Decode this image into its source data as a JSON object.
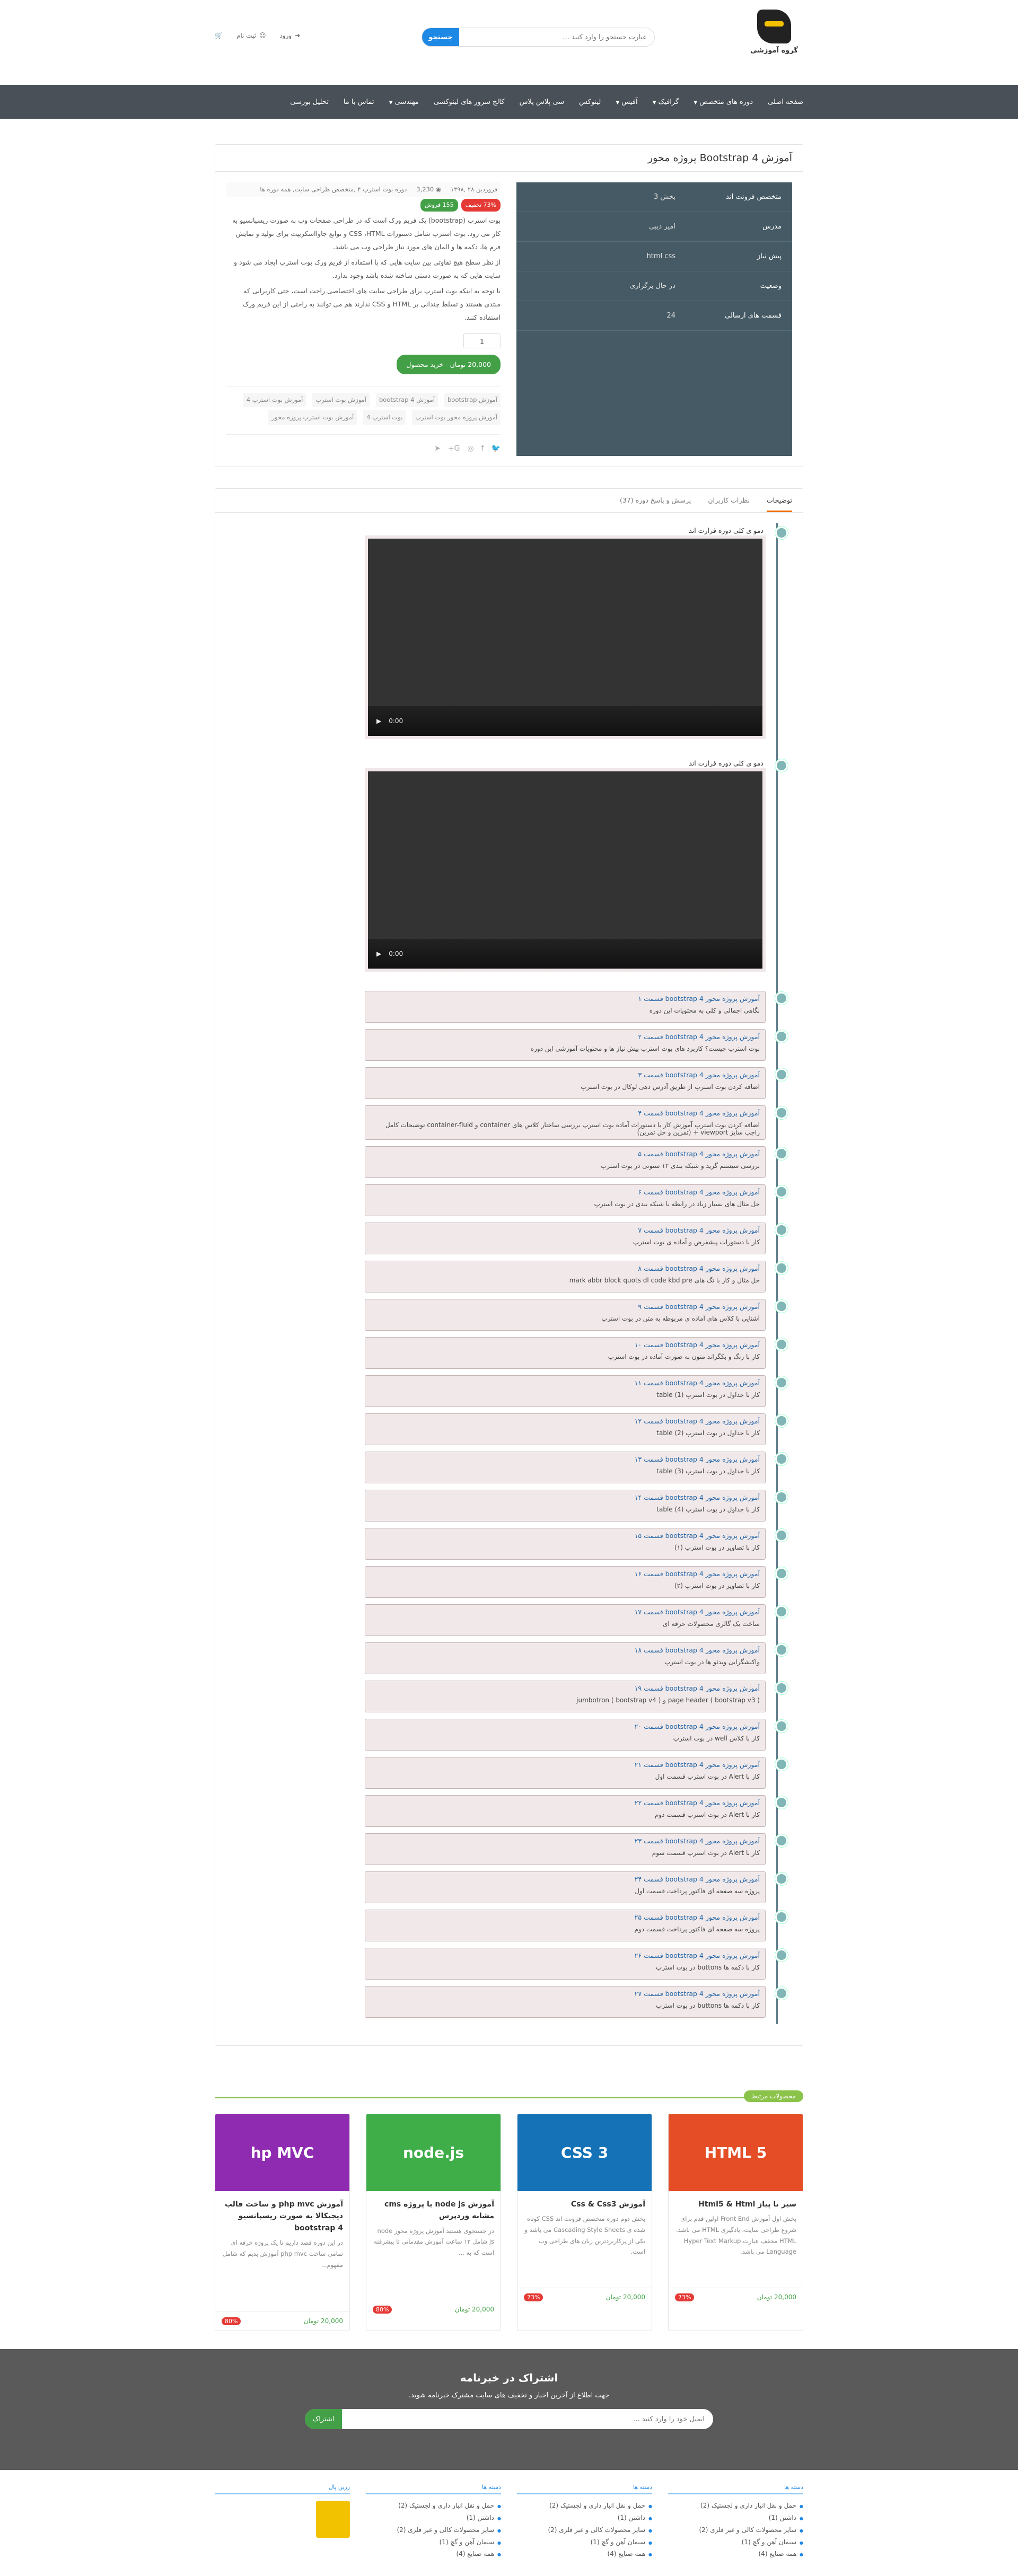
{
  "header": {
    "logo_text": "گروه آموزشی",
    "search": {
      "placeholder": "عبارت جستجو را وارد کنید ...",
      "button": "جستجو"
    },
    "links": {
      "login": "ورود",
      "register": "ثبت نام"
    }
  },
  "nav": [
    "صفحه اصلی",
    "دوره های متخصص",
    "گرافیک",
    "آفیس",
    "لینوکس",
    "سی پلاس پلاس",
    "کالج سرور های لینوکسی",
    "مهندسی",
    "تماس با ما",
    "تحلیل بورسی"
  ],
  "product": {
    "title": "آموزش Bootstrap 4 پروژه محور",
    "info": [
      {
        "k": "متخصص فرونت اند",
        "v": "بخش 3"
      },
      {
        "k": "مدرس",
        "v": "امیر دیبی"
      },
      {
        "k": "پیش نیاز",
        "v": "html css"
      },
      {
        "k": "وضعیت",
        "v": "در حال برگزاری"
      },
      {
        "k": "قسمت های ارسالی",
        "v": "24"
      }
    ],
    "meta": {
      "date": "فروردین ۲۸ ,۱۳۹۸",
      "views": "3,230",
      "category": "دوره بوت استرپ ۴ ,متخصص طراحی سایت, همه دوره ها"
    },
    "discount": "73% تخفیف",
    "remaining": "155 فروش",
    "desc": [
      "بوت استرپ (bootstrap) یک فریم ورک است که در طراحی صفحات وب به صورت ریسپانسیو به کار می رود. بوت استرپ شامل دستورات CSS ،HTML و توابع جاوااسکریپت برای تولید و نمایش فرم ها، دکمه ها و المان های مورد نیاز طراحی وب می باشد.",
      "از نظر سطح هیچ تفاوتی بین سایت هایی که با استفاده از فریم ورک بوت استرپ ایجاد می شود و سایت هایی که به صورت دستی ساخته شده باشد وجود ندارد.",
      "با توجه به اینکه بوت استرپ برای طراحی سایت های اختصاصی راحت است، حتی کاربرانی که مبتدی هستند و تسلط چندانی بر HTML و CSS ندارند هم می توانند به راحتی از این فریم ورک استفاده کنند."
    ],
    "qty": "1",
    "buy": "20,000 تومان - خرید محصول",
    "tags": [
      "آموزش bootstrap",
      "آموزش bootstrap 4",
      "آموزش بوت استرپ",
      "آموزش بوت استرپ 4",
      "آموزش پروژه محور بوت استرپ",
      "بوت استرپ 4",
      "آموزش بوت استرپ پروژه محور"
    ]
  },
  "tabs": [
    "توضیحات",
    "نظرات کاربران",
    "پرسش و پاسخ دوره (37)"
  ],
  "videos": [
    {
      "title": "دمو ی کلی دوره قرارت اند",
      "time": "0:00"
    },
    {
      "title": "دمو ی کلی دوره قرارت اند",
      "time": "0:00"
    }
  ],
  "lessons": [
    {
      "t": "آموزش پروژه محور bootstrap 4 قسمت ۱",
      "s": "نگاهی اجمالی و کلی به محتویات این دوره"
    },
    {
      "t": "آموزش پروژه محور bootstrap 4 قسمت ۲",
      "s": "بوت استرپ چیست؟ کاربرد های بوت استرپ پیش نیاز ها و محتویات آموزشی این دوره"
    },
    {
      "t": "آموزش پروژه محور bootstrap 4 قسمت ۳",
      "s": "اضافه کردن بوت استرپ از طریق آدرس دهی لوکال در بوت استرپ"
    },
    {
      "t": "آموزش پروژه محور bootstrap 4 قسمت ۴",
      "s": "اضافه کردن بوت استرپ آموزش کار با دستورات آماده بوت استرپ بررسی ساختار کلاس های container و container-fluid توضیحات کامل راجب سایز viewport + (تمرین و حل تمرین)"
    },
    {
      "t": "آموزش پروژه محور bootstrap 4 قسمت ۵",
      "s": "بررسی سیستم گرید و شبکه بندی ۱۲ ستونی در بوت استرپ"
    },
    {
      "t": "آموزش پروژه محور bootstrap 4 قسمت ۶",
      "s": "حل مثال های بسیار زیاد در رابطه با شبکه بندی در بوت استرپ"
    },
    {
      "t": "آموزش پروژه محور bootstrap 4 قسمت ۷",
      "s": "کار با دستورات پیشفرض و آماده ی بوت استرپ"
    },
    {
      "t": "آموزش پروژه محور bootstrap 4 قسمت ۸",
      "s": "حل مثال و کار با تگ های mark abbr block quots dl code kbd pre"
    },
    {
      "t": "آموزش پروژه محور bootstrap 4 قسمت ۹",
      "s": "آشنایی با کلاس های آماده ی مربوطه به متن در بوت استرپ"
    },
    {
      "t": "آموزش پروژه محور bootstrap 4 قسمت ۱۰",
      "s": "کار با رنگ و بکگراند متون به صورت آماده در بوت استرپ"
    },
    {
      "t": "آموزش پروژه محور bootstrap 4 قسمت ۱۱",
      "s": "کار با جداول در بوت استرپ table (1)"
    },
    {
      "t": "آموزش پروژه محور bootstrap 4 قسمت ۱۲",
      "s": "کار با جداول در بوت استرپ table (2)"
    },
    {
      "t": "آموزش پروژه محور bootstrap 4 قسمت ۱۳",
      "s": "کار با جداول در بوت استرپ table (3)"
    },
    {
      "t": "آموزش پروژه محور bootstrap 4 قسمت ۱۴",
      "s": "کار با جداول در بوت استرپ table (4)"
    },
    {
      "t": "آموزش پروژه محور bootstrap 4 قسمت ۱۵",
      "s": "کار با تصاویر در بوت استرپ (۱)"
    },
    {
      "t": "آموزش پروژه محور bootstrap 4 قسمت ۱۶",
      "s": "کار با تصاویر در بوت استرپ (۲)"
    },
    {
      "t": "آموزش پروژه محور bootstrap 4 قسمت ۱۷",
      "s": "ساخت یک گالری محصولات حرفه ای"
    },
    {
      "t": "آموزش پروژه محور bootstrap 4 قسمت ۱۸",
      "s": "واکنشگرایی ویدئو ها در بوت استرپ"
    },
    {
      "t": "آموزش پروژه محور bootstrap 4 قسمت ۱۹",
      "s": "page header ( bootstrap v3 ) و jumbotron ( bootstrap v4 )"
    },
    {
      "t": "آموزش پروژه محور bootstrap 4 قسمت ۲۰",
      "s": "کار با کلاس well در بوت استرپ"
    },
    {
      "t": "آموزش پروژه محور bootstrap 4 قسمت ۲۱",
      "s": "کار با Alert در بوت استرپ قسمت اول"
    },
    {
      "t": "آموزش پروژه محور bootstrap 4 قسمت ۲۲",
      "s": "کار با Alert در بوت استرپ قسمت دوم"
    },
    {
      "t": "آموزش پروژه محور bootstrap 4 قسمت ۲۳",
      "s": "کار با Alert در بوت استرپ قسمت سوم"
    },
    {
      "t": "آموزش پروژه محور bootstrap 4 قسمت ۲۴",
      "s": "پروژه سه صفحه ای فاکتور پرداخت قسمت اول"
    },
    {
      "t": "آموزش پروژه محور bootstrap 4 قسمت ۲۵",
      "s": "پروژه سه صفحه ای فاکتور پرداخت قسمت دوم"
    },
    {
      "t": "آموزش پروژه محور bootstrap 4 قسمت ۲۶",
      "s": "کار با دکمه ها buttons در بوت استرپ"
    },
    {
      "t": "آموزش پروژه محور bootstrap 4 قسمت ۲۷",
      "s": "کار با دکمه ها buttons در بوت استرپ"
    }
  ],
  "related": {
    "heading": "محصولات مرتبط",
    "items": [
      {
        "img": "HTML 5",
        "color": "#e44d26",
        "title": "سیر تا پیاز Html5 & Html",
        "desc": "بخش اول آموزش Front End اولین قدم برای شروع طراحی سایت، یادگیری HTML می باشد. HTML مخفف عبارت Hyper Text Markup Language می باشد.",
        "price": "20,000 تومان",
        "off": "73%"
      },
      {
        "img": "CSS 3",
        "color": "#1572b6",
        "title": "آموزش Css & Css3",
        "desc": "بخش دوم دوره متخصص فرونت اند CSS کوتاه شده ی Cascading Style Sheets می باشد و یکی از پرکاربردترین زبان های طراحی وب است.",
        "price": "20,000 تومان",
        "off": "73%"
      },
      {
        "img": "node.js",
        "color": "#3fae49",
        "title": "آموزش node js با پروژه cms مشابه وردپرس",
        "desc": "در جستجوی هستید آموزش پروژه محور node js شامل ۱۲ ساعت آموزش مقدماتی تا پیشرفته است که به ...",
        "price": "20,000 تومان",
        "off": "80%"
      },
      {
        "img": "hp MVC",
        "color": "#8e2bb0",
        "title": "آموزش php mvc و ساخت قالب دیجیکالا به صورت ریسپانسیو bootstrap 4",
        "desc": "در این دوره قصد داریم تا یک پروژه حرفه ای تمامی ساخت php mvc آموزش بدیم که شامل مفهوم...",
        "price": "20,000 تومان",
        "off": "80%"
      }
    ]
  },
  "newsletter": {
    "title": "اشتراک در خبرنامه",
    "subtitle": "جهت اطلاع از آخرین اخبار و تخفیف های سایت مشترک خبرنامه شوید.",
    "placeholder": "ایمیل خود را وارد کنید ...",
    "button": "اشتراک"
  },
  "footer": [
    {
      "h": "دسته ها",
      "items": [
        "حمل و نقل انبار داری و لجستیک (2)",
        "داشتن (1)",
        "سایر محصولات کالی و غیر فلزی (2)",
        "سیمان آهن و گچ (1)",
        "همه صنایع (4)"
      ]
    },
    {
      "h": "دسته ها",
      "items": [
        "حمل و نقل انبار داری و لجستیک (2)",
        "داشتن (1)",
        "سایر محصولات کالی و غیر فلزی (2)",
        "سیمان آهن و گچ (1)",
        "همه صنایع (4)"
      ]
    },
    {
      "h": "دسته ها",
      "items": [
        "حمل و نقل انبار داری و لجستیک (2)",
        "داشتن (1)",
        "سایر محصولات کالی و غیر فلزی (2)",
        "سیمان آهن و گچ (1)",
        "همه صنایع (4)"
      ]
    },
    {
      "h": "زرین پال",
      "items": []
    }
  ]
}
